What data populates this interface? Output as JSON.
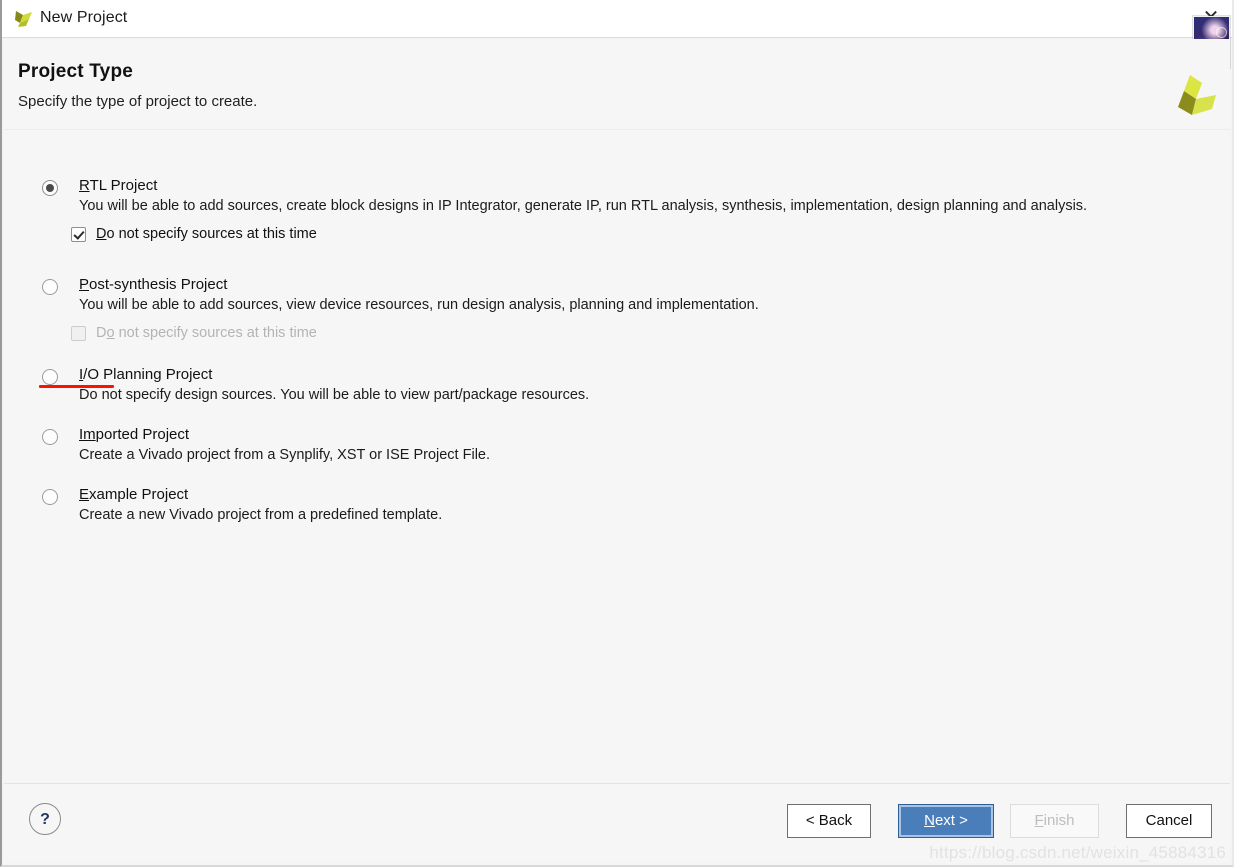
{
  "window": {
    "title": "New Project",
    "icon": "vivado-logo-icon",
    "close_label": "✕"
  },
  "header": {
    "title": "Project Type",
    "subtitle": "Specify the type of project to create.",
    "brand_icon": "xilinx-logo-icon"
  },
  "options": [
    {
      "id": "rtl-project",
      "mnemonic": "R",
      "title_rest": "TL Project",
      "description": "You will be able to add sources, create block designs in IP Integrator, generate IP, run RTL analysis, synthesis, implementation, design planning and analysis.",
      "selected": true,
      "checkbox": {
        "mnemonic": "D",
        "label_rest": "o not specify sources at this time",
        "checked": true,
        "disabled": false
      }
    },
    {
      "id": "post-synthesis-project",
      "mnemonic": "P",
      "title_rest": "ost-synthesis Project",
      "description": "You will be able to add sources, view device resources, run design analysis, planning and implementation.",
      "selected": false,
      "checkbox": {
        "prefix": "D",
        "mnemonic": "o",
        "label_rest": " not specify sources at this time",
        "checked": false,
        "disabled": true
      }
    },
    {
      "id": "io-planning-project",
      "mnemonic": "I",
      "title_rest": "/O Planning Project",
      "description": "Do not specify design sources. You will be able to view part/package resources.",
      "selected": false,
      "checkbox": null
    },
    {
      "id": "imported-project",
      "mnemonic": "Im",
      "title_rest": "ported Project",
      "description": "Create a Vivado project from a Synplify, XST or ISE Project File.",
      "selected": false,
      "checkbox": null
    },
    {
      "id": "example-project",
      "mnemonic": "E",
      "title_rest": "xample Project",
      "description": "Create a new Vivado project from a predefined template.",
      "selected": false,
      "checkbox": null
    }
  ],
  "footer": {
    "help_label": "?",
    "back_label": "< Back",
    "next_mnemonic": "N",
    "next_rest": "ext >",
    "finish_mnemonic": "F",
    "finish_rest": "inish",
    "cancel_label": "Cancel"
  },
  "annotation": {
    "red_underline": true
  },
  "watermark": {
    "text": "https://blog.csdn.net/weixin_45884316"
  },
  "colors": {
    "accent_blue": "#4a7ebb",
    "annotation_red": "#fb1300",
    "logo_olive": "#8a8c1b",
    "logo_yellow": "#d6e23a",
    "body_bg": "#f6f6f6"
  }
}
